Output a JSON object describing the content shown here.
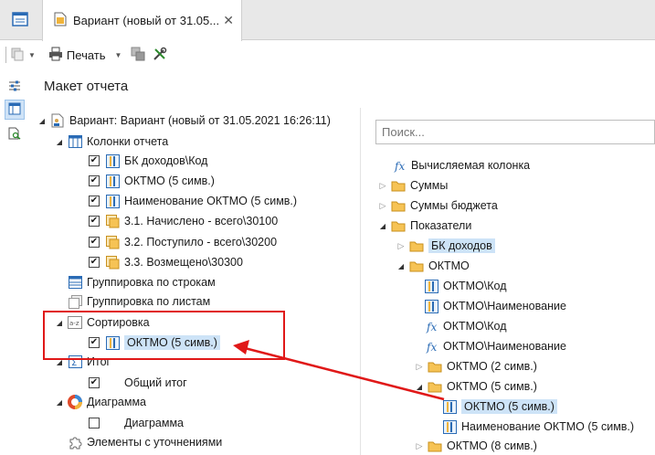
{
  "tab": {
    "title": "Вариант (новый от 31.05...",
    "close": "✕"
  },
  "toolbar": {
    "print_label": "Печать"
  },
  "panel": {
    "title": "Макет отчета"
  },
  "left_tree": {
    "root": "Вариант: Вариант (новый от 31.05.2021 16:26:11)",
    "columns_label": "Колонки отчета",
    "columns": [
      "БК доходов\\Код",
      "ОКТМО (5 симв.)",
      "Наименование ОКТМО (5 симв.)",
      "3.1. Начислено - всего\\30100",
      "3.2. Поступило - всего\\30200",
      "3.3. Возмещено\\30300"
    ],
    "group_rows": "Группировка по строкам",
    "group_sheets": "Группировка по листам",
    "sort": "Сортировка",
    "sort_item": "ОКТМО (5 симв.)",
    "total": "Итог",
    "total_item": "Общий итог",
    "chart": "Диаграмма",
    "chart_item": "Диаграмма",
    "refinements": "Элементы с уточнениями"
  },
  "right_tree": {
    "search_placeholder": "Поиск...",
    "computed": "Вычисляемая колонка",
    "sums": "Суммы",
    "budget_sums": "Суммы бюджета",
    "indicators": "Показатели",
    "bk_income": "БК доходов",
    "oktmo": "ОКТМО",
    "oktmo_code": "ОКТМО\\Код",
    "oktmo_name": "ОКТМО\\Наименование",
    "f_oktmo_code": "ОКТМО\\Код",
    "f_oktmo_name": "ОКТМО\\Наименование",
    "oktmo2": "ОКТМО (2 симв.)",
    "oktmo5": "ОКТМО (5 симв.)",
    "oktmo5_item": "ОКТМО (5 симв.)",
    "oktmo5_name": "Наименование ОКТМО (5 симв.)",
    "oktmo8": "ОКТМО (8 симв.)"
  },
  "colors": {
    "highlight": "#e01818",
    "selection": "#cde3f7"
  }
}
